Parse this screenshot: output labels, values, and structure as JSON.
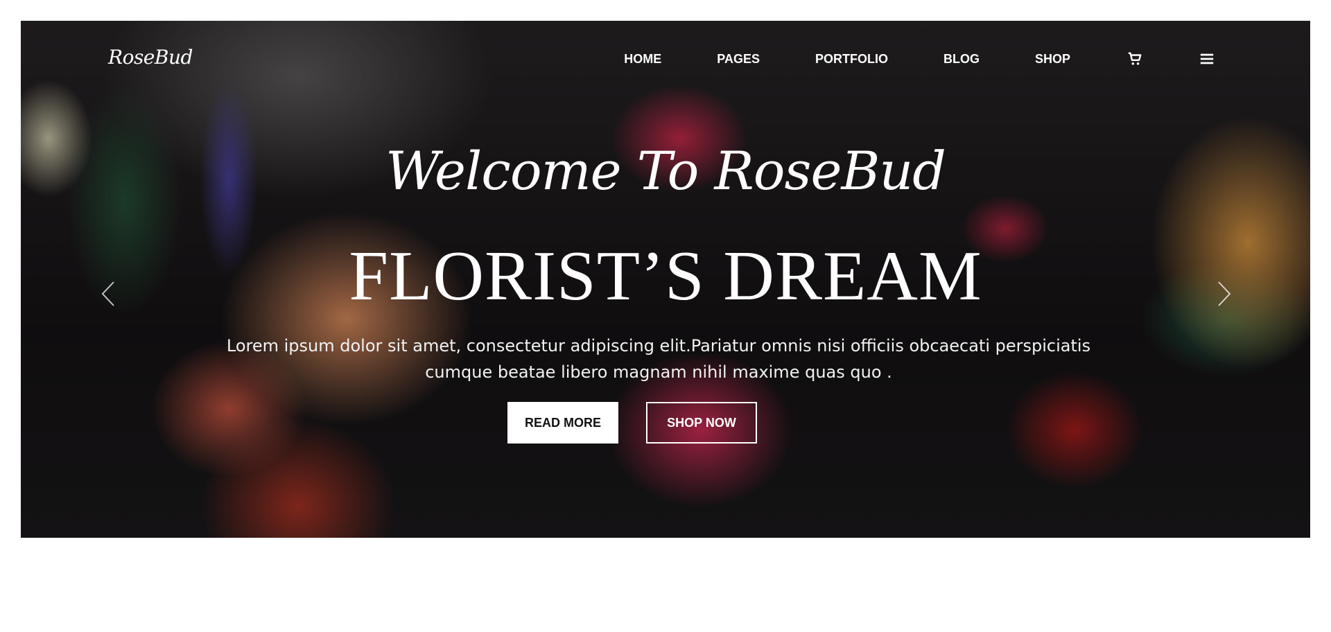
{
  "header": {
    "logo": "RoseBud",
    "nav": [
      "HOME",
      "PAGES",
      "PORTFOLIO",
      "BLOG",
      "SHOP"
    ],
    "icons": [
      "shopping-cart-icon",
      "hamburger-menu-icon"
    ]
  },
  "hero": {
    "welcome": "Welcome To RoseBud",
    "headline": "FLORIST’S DREAM",
    "tagline_line1": "Lorem ipsum dolor sit amet, consectetur adipiscing elit.Pariatur omnis nisi officiis obcaecati perspiciatis",
    "tagline_line2": "cumque beatae libero magnam nihil maxime quas quo .",
    "read_more": "READ MORE",
    "shop_now": "SHOP NOW",
    "arrows": [
      "chevron-left-icon",
      "chevron-right-icon"
    ]
  },
  "colors": {
    "text": "#ffffff",
    "button_fill": "#ffffff",
    "page_background": "#ffffff"
  }
}
